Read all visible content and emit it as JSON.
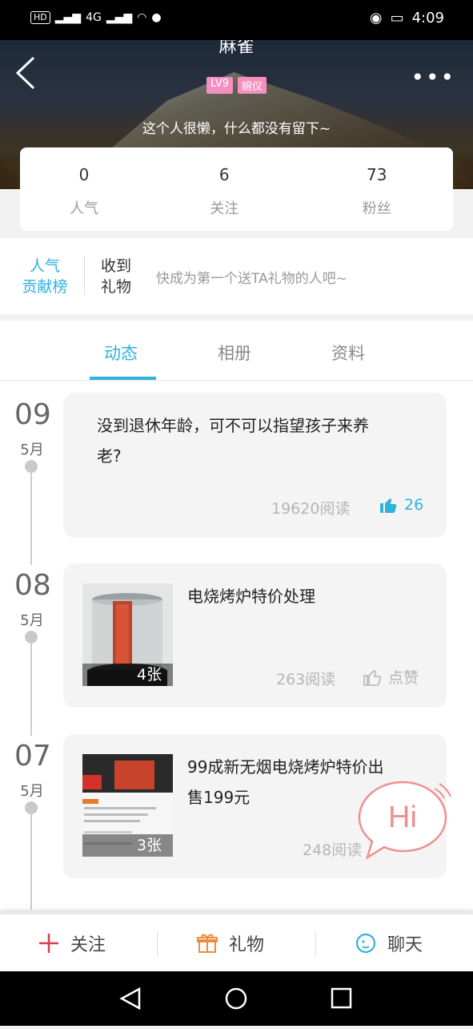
{
  "status_bar": {
    "left": "HD",
    "network": "4G",
    "time": "4:09"
  },
  "profile": {
    "nickname": "麻雀",
    "tags": [
      "LV9",
      "婉仪"
    ],
    "bio": "这个人很懒，什么都没有留下~",
    "stats": [
      {
        "value": "0",
        "label": "人气"
      },
      {
        "value": "6",
        "label": "关注"
      },
      {
        "value": "73",
        "label": "粉丝"
      }
    ]
  },
  "gifts": {
    "rank_line1": "人气",
    "rank_line2": "贡献榜",
    "received_line1": "收到",
    "received_line2": "礼物",
    "hint": "快成为第一个送TA礼物的人吧~"
  },
  "tabs": [
    {
      "label": "动态",
      "active": true
    },
    {
      "label": "相册",
      "active": false
    },
    {
      "label": "资料",
      "active": false
    }
  ],
  "posts": [
    {
      "day": "09",
      "month": "5月",
      "text_line1": "没到退休年龄，可不可以指望孩子来养",
      "text_line2": "老?",
      "reads": "19620阅读",
      "likes": "26"
    },
    {
      "day": "08",
      "month": "5月",
      "text_line1": "电烧烤炉特价处理",
      "photo_count": "4张",
      "reads": "263阅读",
      "likes": "点赞"
    },
    {
      "day": "07",
      "month": "5月",
      "text_line1": "99成新无烟电烧烤炉特价出",
      "text_line2": "售199元",
      "photo_count": "3张",
      "reads": "248阅读"
    }
  ],
  "hi_bubble": "Hi",
  "action_bar": {
    "follow": "关注",
    "gift": "礼物",
    "chat": "聊天"
  },
  "colors": {
    "accent": "#2fb2dd",
    "tag": "#f58fc0",
    "follow": "#e0394a",
    "gift": "#f08a3e"
  }
}
